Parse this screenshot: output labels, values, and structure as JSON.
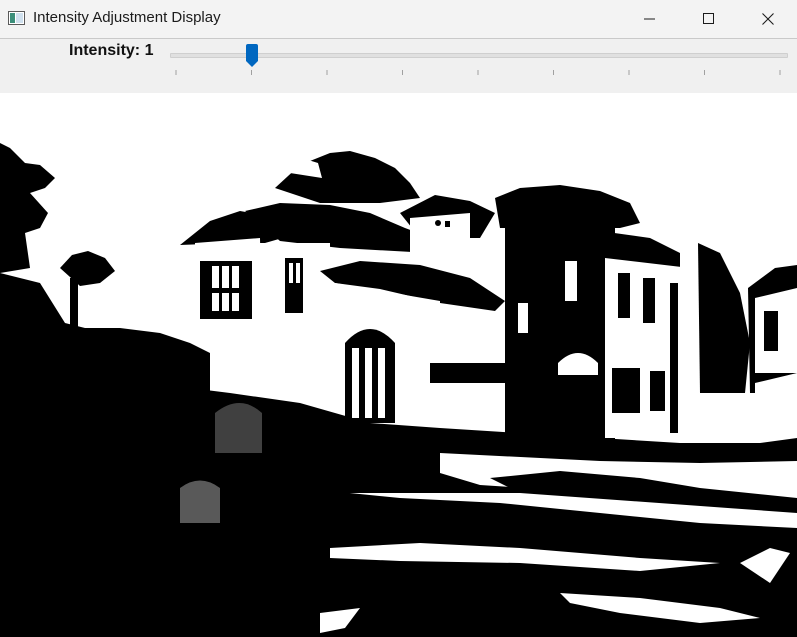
{
  "window": {
    "title": "Intensity Adjustment Display",
    "icon": "app-window-icon",
    "controls": [
      "minimize-icon",
      "maximize-icon",
      "close-icon"
    ]
  },
  "slider": {
    "label": "Intensity: 1",
    "value": 1,
    "min": 0,
    "max": 8,
    "tick_count": 9,
    "accent_color": "#0067c0"
  },
  "image": {
    "content": "thresholded black-and-white photograph of a Mediterranean-style house with palm trees"
  }
}
